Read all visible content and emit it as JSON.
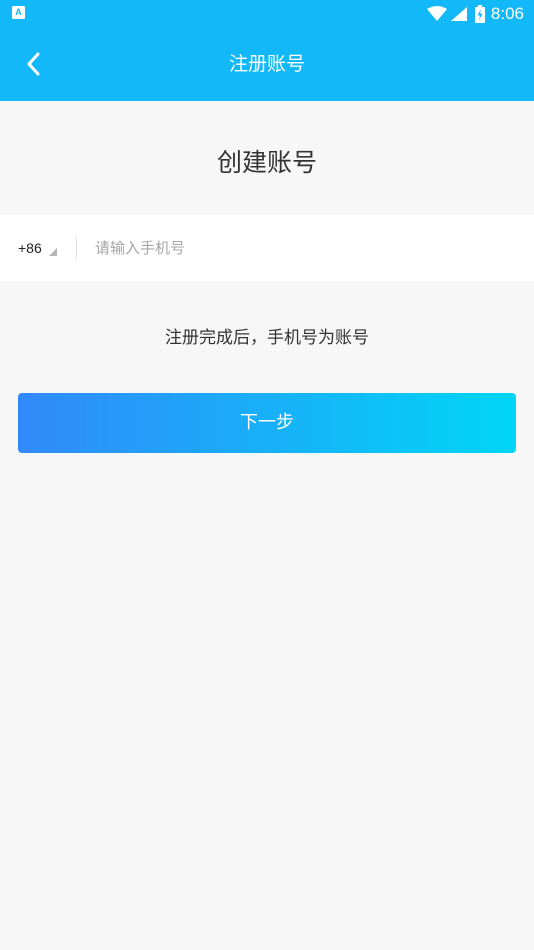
{
  "status_bar": {
    "app_icon_letter": "A",
    "time": "8:06",
    "icons": [
      "wifi-icon",
      "signal-icon",
      "battery-icon"
    ]
  },
  "nav": {
    "title": "注册账号",
    "back_icon": "chevron-left-icon"
  },
  "page": {
    "heading": "创建账号"
  },
  "phone": {
    "country_code": "+86",
    "placeholder": "请输入手机号",
    "value": ""
  },
  "hint": "注册完成后，手机号为账号",
  "next_button": {
    "label": "下一步"
  },
  "colors": {
    "primary": "#12b8f7",
    "background": "#f7f7f8",
    "button_gradient_start": "#3189f9",
    "button_gradient_end": "#00d6f7"
  }
}
